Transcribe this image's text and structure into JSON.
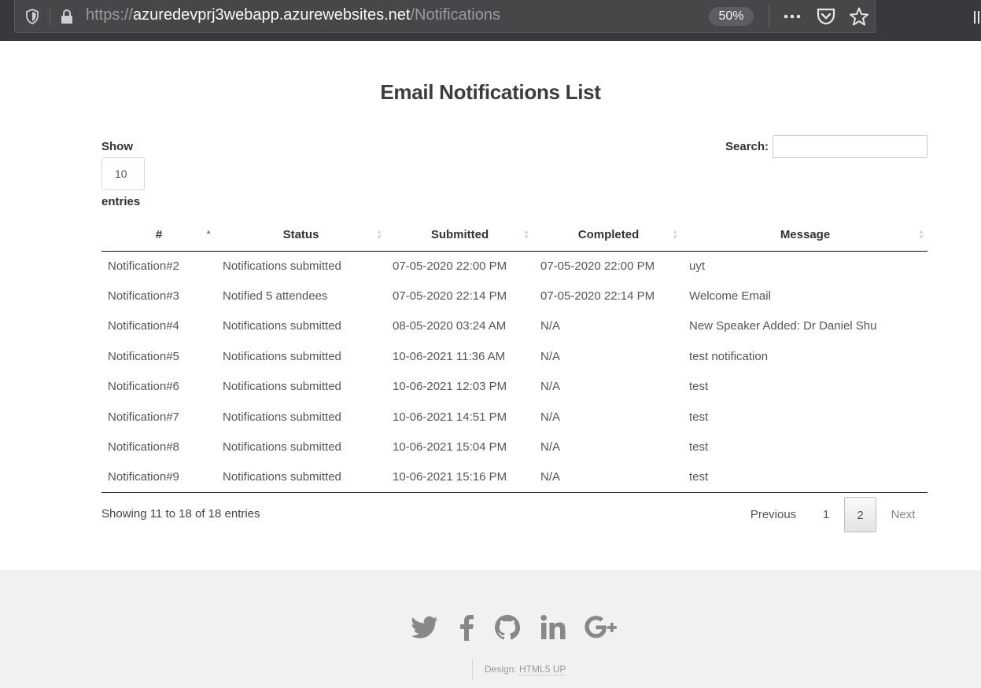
{
  "browser": {
    "url_scheme": "https://",
    "url_host": "azuredevprj3webapp.azurewebsites.net",
    "url_path": "/Notifications",
    "zoom": "50%"
  },
  "page": {
    "title": "Email Notifications List"
  },
  "length_menu": {
    "show_label": "Show",
    "value": "10",
    "entries_label": "entries"
  },
  "search": {
    "label": "Search:",
    "value": ""
  },
  "table": {
    "headers": [
      "#",
      "Status",
      "Submitted",
      "Completed",
      "Message"
    ],
    "rows": [
      [
        "Notification#2",
        "Notifications submitted",
        "07-05-2020 22:00 PM",
        "07-05-2020 22:00 PM",
        "uyt"
      ],
      [
        "Notification#3",
        "Notified 5 attendees",
        "07-05-2020 22:14 PM",
        "07-05-2020 22:14 PM",
        "Welcome Email"
      ],
      [
        "Notification#4",
        "Notifications submitted",
        "08-05-2020 03:24 AM",
        "N/A",
        "New Speaker Added: Dr Daniel Shu"
      ],
      [
        "Notification#5",
        "Notifications submitted",
        "10-06-2021 11:36 AM",
        "N/A",
        "test notification"
      ],
      [
        "Notification#6",
        "Notifications submitted",
        "10-06-2021 12:03 PM",
        "N/A",
        "test"
      ],
      [
        "Notification#7",
        "Notifications submitted",
        "10-06-2021 14:51 PM",
        "N/A",
        "test"
      ],
      [
        "Notification#8",
        "Notifications submitted",
        "10-06-2021 15:04 PM",
        "N/A",
        "test"
      ],
      [
        "Notification#9",
        "Notifications submitted",
        "10-06-2021 15:16 PM",
        "N/A",
        "test"
      ]
    ]
  },
  "info": "Showing 11 to 18 of 18 entries",
  "pagination": {
    "previous": "Previous",
    "pages": [
      "1",
      "2"
    ],
    "current": "2",
    "next": "Next"
  },
  "footer": {
    "social_icons": [
      "twitter-icon",
      "facebook-icon",
      "github-icon",
      "linkedin-icon",
      "google-plus-icon"
    ],
    "credit_prefix": "Design:",
    "credit_link": "HTML5 UP"
  },
  "colors": {
    "toolbar_bg": "#38383d",
    "footer_bg": "#f1f1f1",
    "icon_gray": "#888888"
  }
}
